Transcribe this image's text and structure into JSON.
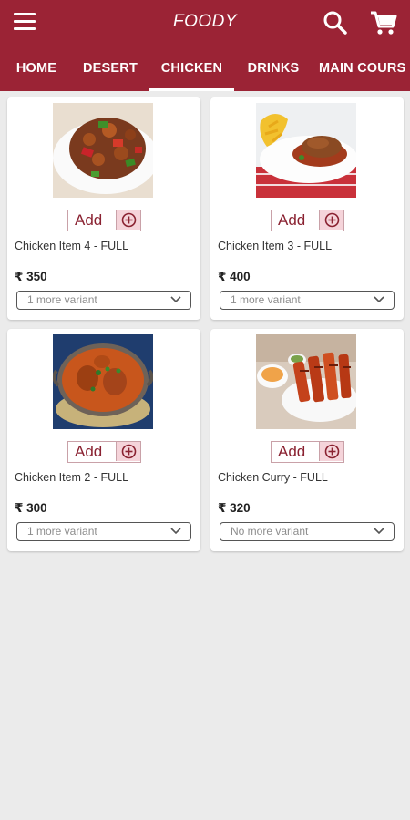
{
  "app": {
    "title": "FOODY",
    "brand_color": "#9b2335"
  },
  "header": {
    "menu_icon": "hamburger-menu-icon",
    "search_icon": "search-icon",
    "cart_icon": "cart-icon"
  },
  "tabs": [
    {
      "label": "HOME"
    },
    {
      "label": "DESERT"
    },
    {
      "label": "CHICKEN",
      "active": true
    },
    {
      "label": "DRINKS"
    },
    {
      "label": "MAIN COURS"
    }
  ],
  "products": [
    {
      "name": "Chicken Item 4 - FULL",
      "price": "₹ 350",
      "variant": "1 more variant",
      "add_label": "Add"
    },
    {
      "name": "Chicken Item 3 - FULL",
      "price": "₹ 400",
      "variant": "1 more variant",
      "add_label": "Add"
    },
    {
      "name": "Chicken Item 2 - FULL",
      "price": "₹ 300",
      "variant": "1 more variant",
      "add_label": "Add"
    },
    {
      "name": "Chicken Curry - FULL",
      "price": "₹ 320",
      "variant": "No more variant",
      "add_label": "Add"
    }
  ]
}
